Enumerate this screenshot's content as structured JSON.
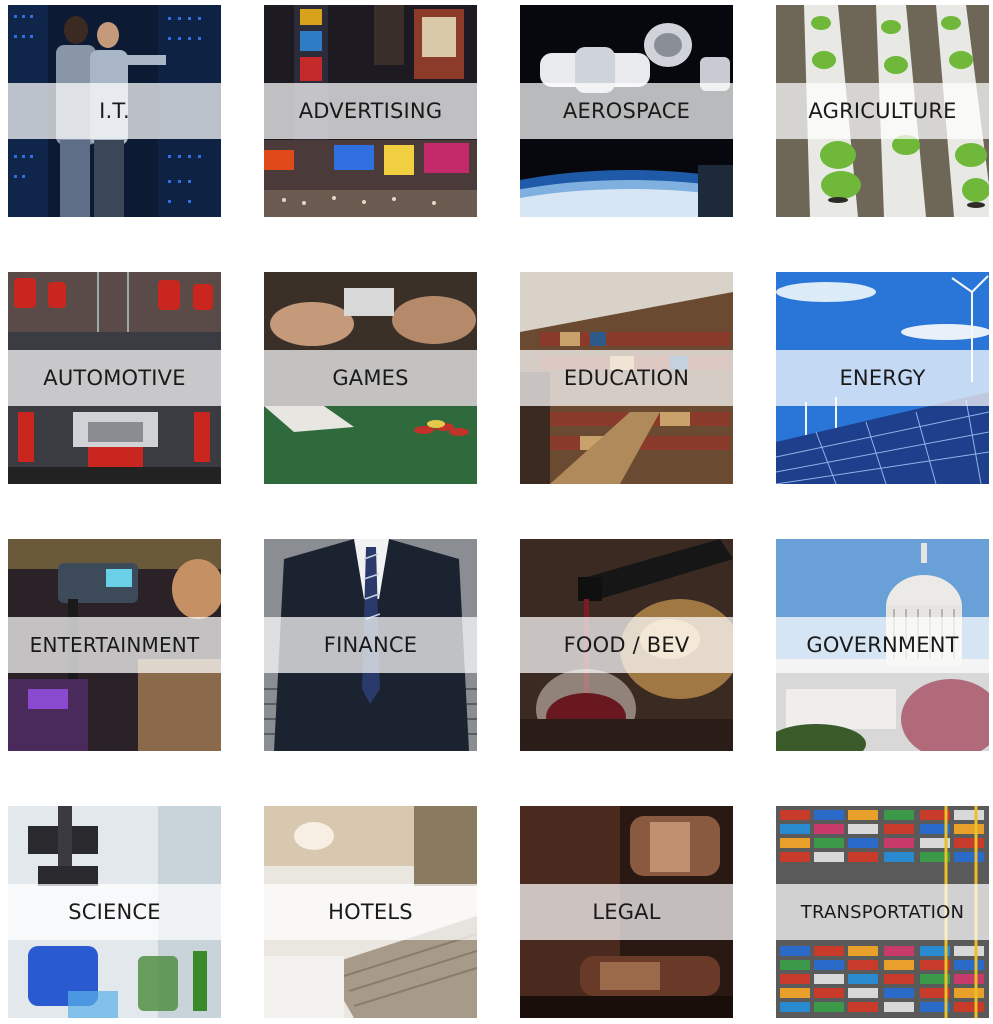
{
  "tiles": [
    {
      "label": "I.T.",
      "icon": "data-center-image"
    },
    {
      "label": "ADVERTISING",
      "icon": "times-square-image"
    },
    {
      "label": "AEROSPACE",
      "icon": "spacecraft-image"
    },
    {
      "label": "AGRICULTURE",
      "icon": "hydroponic-plants-image"
    },
    {
      "label": "AUTOMOTIVE",
      "icon": "robotic-assembly-line-image"
    },
    {
      "label": "GAMES",
      "icon": "card-table-image"
    },
    {
      "label": "EDUCATION",
      "icon": "library-bookshelves-image"
    },
    {
      "label": "ENERGY",
      "icon": "solar-wind-image"
    },
    {
      "label": "ENTERTAINMENT",
      "icon": "camera-operator-image"
    },
    {
      "label": "FINANCE",
      "icon": "business-suit-image"
    },
    {
      "label": "FOOD / BEV",
      "icon": "wine-pour-image"
    },
    {
      "label": "GOVERNMENT",
      "icon": "capitol-building-image"
    },
    {
      "label": "SCIENCE",
      "icon": "lab-microscope-image"
    },
    {
      "label": "HOTELS",
      "icon": "hotel-bed-image"
    },
    {
      "label": "LEGAL",
      "icon": "gavel-image"
    },
    {
      "label": "TRANSPORTATION",
      "icon": "shipping-containers-image"
    }
  ]
}
